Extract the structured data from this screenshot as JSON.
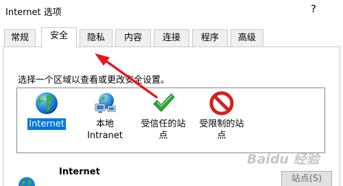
{
  "window": {
    "title": "Internet 选项",
    "help_label": "?"
  },
  "tabs": [
    {
      "label": "常规",
      "active": false
    },
    {
      "label": "安全",
      "active": true
    },
    {
      "label": "隐私",
      "active": false
    },
    {
      "label": "内容",
      "active": false
    },
    {
      "label": "连接",
      "active": false
    },
    {
      "label": "程序",
      "active": false
    },
    {
      "label": "高级",
      "active": false
    }
  ],
  "security": {
    "instruction": "选择一个区域以查看或更改安全设置。",
    "zones": [
      {
        "label": "Internet",
        "icon": "globe-icon",
        "selected": true
      },
      {
        "label": "本地\nIntranet",
        "icon": "network-icon",
        "selected": false
      },
      {
        "label": "受信任的站\n点",
        "icon": "checkmark-icon",
        "selected": false
      },
      {
        "label": "受限制的站\n点",
        "icon": "no-entry-icon",
        "selected": false
      }
    ],
    "zone_heading": "Internet",
    "sites_button": "站点(S)"
  },
  "colors": {
    "selection": "#0078d7",
    "annotation_arrow": "#e8131b"
  },
  "watermark": "Baidu 经验"
}
